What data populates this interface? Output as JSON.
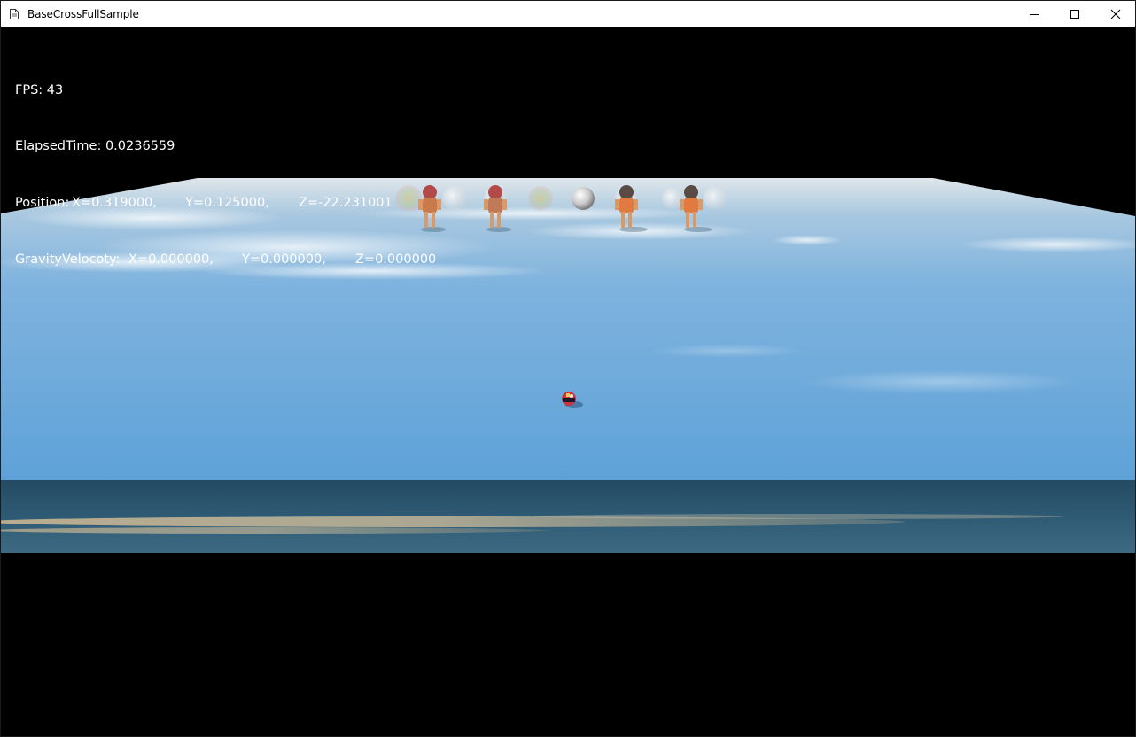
{
  "window": {
    "title": "BaseCrossFullSample",
    "icon": "document-icon",
    "controls": {
      "minimize_icon": "minimize-icon",
      "maximize_icon": "maximize-icon",
      "close_icon": "close-icon"
    }
  },
  "hud": {
    "fps": "FPS: 43",
    "elapsed": "ElapsedTime: 0.0236559",
    "position": {
      "label": "Position:",
      "x": "X=0.319000,",
      "y": "Y=0.125000,",
      "z": "Z=-22.231001"
    },
    "gravity": {
      "label": "GravityVelocoty:",
      "x": "X=0.000000,",
      "y": "Y=0.000000,",
      "z": "Z=0.000000"
    }
  },
  "scene": {
    "colors": {
      "sky_ground_far": "#dfe6ea",
      "ground_mid": "#7fb3de",
      "ground_near": "#5ea2d8",
      "water_top": "#244a63",
      "water_bottom": "#3d6a82",
      "sand_streak": "#c9b592",
      "player_red": "#c8353f"
    },
    "objects": [
      "player-ball",
      "character",
      "character",
      "character",
      "character",
      "sphere",
      "sphere",
      "sphere"
    ]
  }
}
